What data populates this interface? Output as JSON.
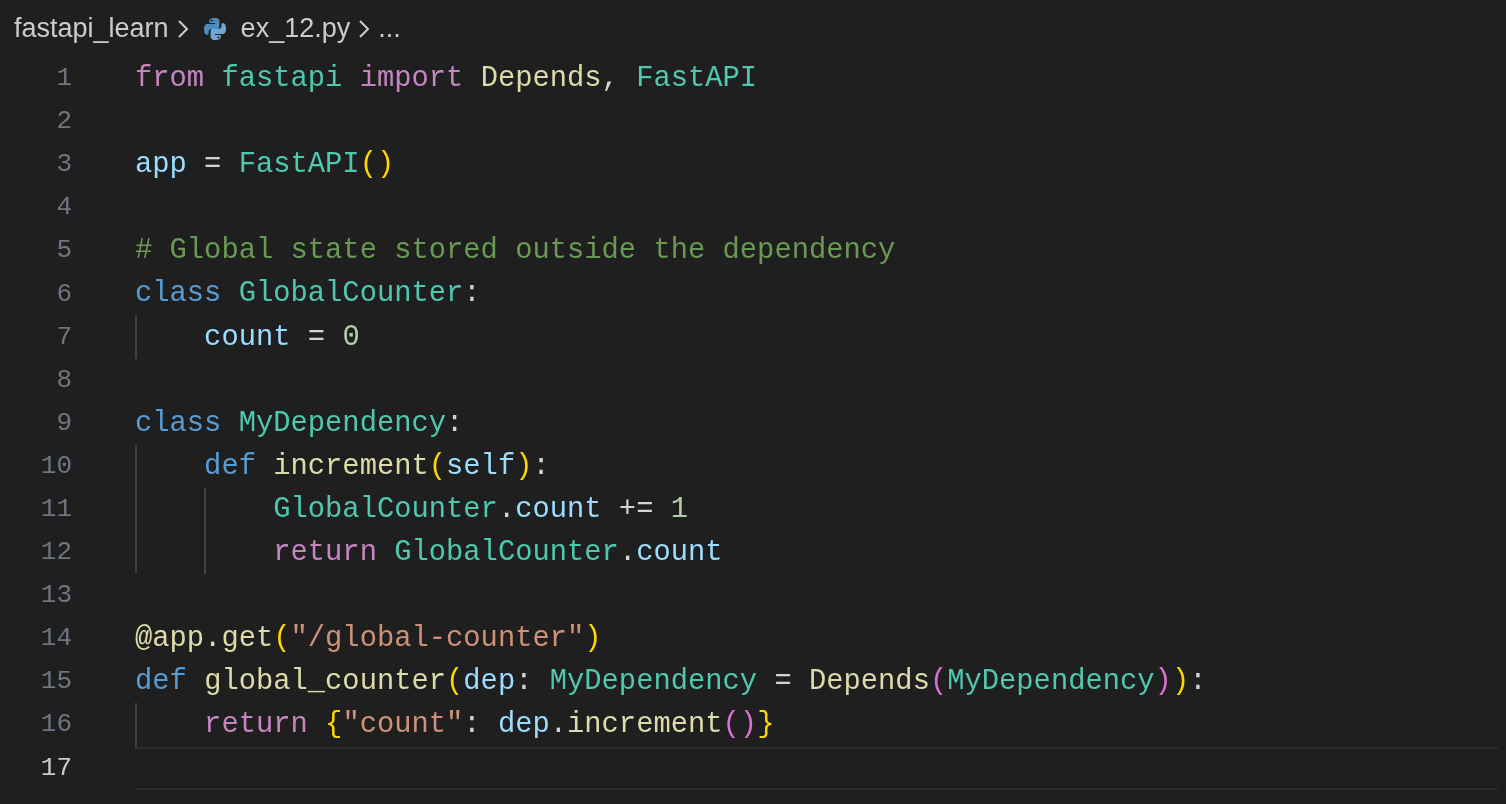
{
  "breadcrumb": [
    {
      "text": "fastapi_learn",
      "kind": "folder"
    },
    {
      "text": "ex_12.py",
      "kind": "file"
    },
    {
      "text": "...",
      "kind": "more"
    }
  ],
  "lines": [
    {
      "number": "1",
      "current": false,
      "tokens": [
        {
          "text": "from ",
          "kind": "keyword"
        },
        {
          "text": "fastapi ",
          "kind": "type"
        },
        {
          "text": "import ",
          "kind": "keyword"
        },
        {
          "text": "Depends",
          "kind": "function"
        },
        {
          "text": ", ",
          "kind": "plain"
        },
        {
          "text": "FastAPI",
          "kind": "type"
        }
      ]
    },
    {
      "number": "2",
      "current": false
    },
    {
      "number": "3",
      "current": false,
      "tokens": [
        {
          "text": "app",
          "kind": "variable"
        },
        {
          "text": " = ",
          "kind": "plain"
        },
        {
          "text": "FastAPI",
          "kind": "type"
        },
        {
          "text": "()",
          "kind": "bracket1"
        }
      ]
    },
    {
      "number": "4",
      "current": false
    },
    {
      "number": "5",
      "current": false,
      "tokens": [
        {
          "text": "# Global state stored outside the dependency",
          "kind": "comment"
        }
      ]
    },
    {
      "number": "6",
      "current": false,
      "tokens": [
        {
          "text": "class ",
          "kind": "storage"
        },
        {
          "text": "GlobalCounter",
          "kind": "type"
        },
        {
          "text": ":",
          "kind": "plain"
        }
      ]
    },
    {
      "number": "7",
      "current": false,
      "tokens": [
        {
          "text": "    count",
          "kind": "variable"
        },
        {
          "text": " = ",
          "kind": "plain"
        },
        {
          "text": "0",
          "kind": "number"
        }
      ]
    },
    {
      "number": "8",
      "current": false
    },
    {
      "number": "9",
      "current": false,
      "tokens": [
        {
          "text": "class ",
          "kind": "storage"
        },
        {
          "text": "MyDependency",
          "kind": "type"
        },
        {
          "text": ":",
          "kind": "plain"
        }
      ]
    },
    {
      "number": "10",
      "current": false,
      "tokens": [
        {
          "text": "    def ",
          "kind": "storage"
        },
        {
          "text": "increment",
          "kind": "function"
        },
        {
          "text": "(",
          "kind": "bracket1"
        },
        {
          "text": "self",
          "kind": "variable"
        },
        {
          "text": ")",
          "kind": "bracket1"
        },
        {
          "text": ":",
          "kind": "plain"
        }
      ]
    },
    {
      "number": "11",
      "current": false,
      "tokens": [
        {
          "text": "        GlobalCounter",
          "kind": "type"
        },
        {
          "text": ".",
          "kind": "plain"
        },
        {
          "text": "count",
          "kind": "variable"
        },
        {
          "text": " += ",
          "kind": "plain"
        },
        {
          "text": "1",
          "kind": "number"
        }
      ]
    },
    {
      "number": "12",
      "current": false,
      "tokens": [
        {
          "text": "        return ",
          "kind": "keyword"
        },
        {
          "text": "GlobalCounter",
          "kind": "type"
        },
        {
          "text": ".",
          "kind": "plain"
        },
        {
          "text": "count",
          "kind": "variable"
        }
      ]
    },
    {
      "number": "13",
      "current": false
    },
    {
      "number": "14",
      "current": false,
      "tokens": [
        {
          "text": "@app.get",
          "kind": "function"
        },
        {
          "text": "(",
          "kind": "bracket1"
        },
        {
          "text": "\"/global-counter\"",
          "kind": "string"
        },
        {
          "text": ")",
          "kind": "bracket1"
        }
      ]
    },
    {
      "number": "15",
      "current": false,
      "tokens": [
        {
          "text": "def ",
          "kind": "storage"
        },
        {
          "text": "global_counter",
          "kind": "function"
        },
        {
          "text": "(",
          "kind": "bracket1"
        },
        {
          "text": "dep",
          "kind": "variable"
        },
        {
          "text": ": ",
          "kind": "plain"
        },
        {
          "text": "MyDependency",
          "kind": "type"
        },
        {
          "text": " = ",
          "kind": "plain"
        },
        {
          "text": "Depends",
          "kind": "function"
        },
        {
          "text": "(",
          "kind": "bracket2"
        },
        {
          "text": "MyDependency",
          "kind": "type"
        },
        {
          "text": ")",
          "kind": "bracket2"
        },
        {
          "text": ")",
          "kind": "bracket1"
        },
        {
          "text": ":",
          "kind": "plain"
        }
      ]
    },
    {
      "number": "16",
      "current": false,
      "tokens": [
        {
          "text": "    return ",
          "kind": "keyword"
        },
        {
          "text": "{",
          "kind": "bracket1"
        },
        {
          "text": "\"count\"",
          "kind": "string"
        },
        {
          "text": ": ",
          "kind": "plain"
        },
        {
          "text": "dep",
          "kind": "variable"
        },
        {
          "text": ".",
          "kind": "plain"
        },
        {
          "text": "increment",
          "kind": "function"
        },
        {
          "text": "()",
          "kind": "bracket2"
        },
        {
          "text": "}",
          "kind": "bracket1"
        }
      ]
    },
    {
      "number": "17",
      "current": true
    }
  ]
}
